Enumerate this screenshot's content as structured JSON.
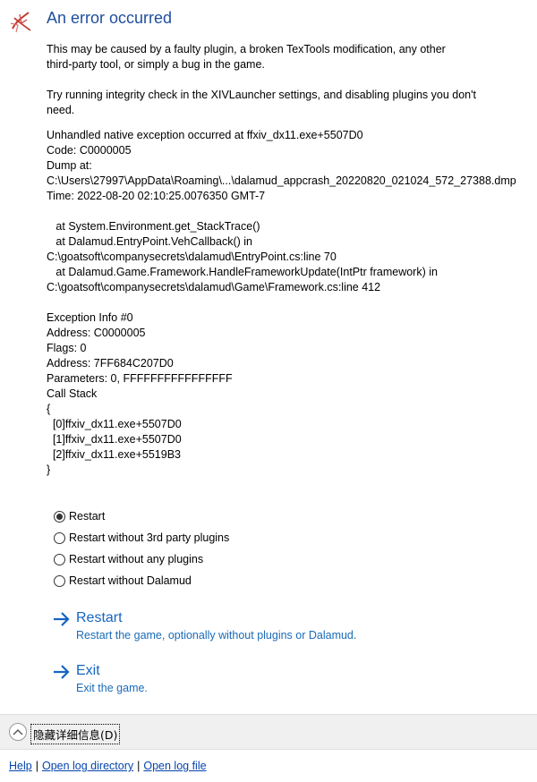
{
  "window": {
    "title": "An error occurred",
    "icon": "dalamud-logo-icon"
  },
  "message": {
    "paragraph1": "This may be caused by a faulty plugin, a broken TexTools modification, any other\nthird-party tool, or simply a bug in the game.",
    "paragraph2": "Try running integrity check in the XIVLauncher settings, and disabling plugins you don't\nneed."
  },
  "details": {
    "text": "Unhandled native exception occurred at ffxiv_dx11.exe+5507D0\nCode: C0000005\nDump at:\nC:\\Users\\27997\\AppData\\Roaming\\...\\dalamud_appcrash_20220820_021024_572_27388.dmp\nTime: 2022-08-20 02:10:25.0076350 GMT-7\n\n   at System.Environment.get_StackTrace()\n   at Dalamud.EntryPoint.VehCallback() in\nC:\\goatsoft\\companysecrets\\dalamud\\EntryPoint.cs:line 70\n   at Dalamud.Game.Framework.HandleFrameworkUpdate(IntPtr framework) in\nC:\\goatsoft\\companysecrets\\dalamud\\Game\\Framework.cs:line 412\n\nException Info #0\nAddress: C0000005\nFlags: 0\nAddress: 7FF684C207D0\nParameters: 0, FFFFFFFFFFFFFFFF\nCall Stack\n{\n  [0]ffxiv_dx11.exe+5507D0\n  [1]ffxiv_dx11.exe+5507D0\n  [2]ffxiv_dx11.exe+5519B3\n}"
  },
  "options": {
    "selected_index": 0,
    "items": [
      {
        "label": "Restart"
      },
      {
        "label": "Restart without 3rd party plugins"
      },
      {
        "label": "Restart without any plugins"
      },
      {
        "label": "Restart without Dalamud"
      }
    ]
  },
  "commands": {
    "restart": {
      "title": "Restart",
      "subtitle": "Restart the game, optionally without plugins or Dalamud."
    },
    "exit": {
      "title": "Exit",
      "subtitle": "Exit the game."
    }
  },
  "footer": {
    "expander_icon": "chevron-up-icon",
    "details_button": "隐藏详细信息(D)",
    "links": [
      "Help",
      "Open log directory",
      "Open log file"
    ],
    "separator": "|"
  },
  "colors": {
    "title": "#1f4e9e",
    "command": "#1565c0",
    "link": "#0645ad"
  }
}
